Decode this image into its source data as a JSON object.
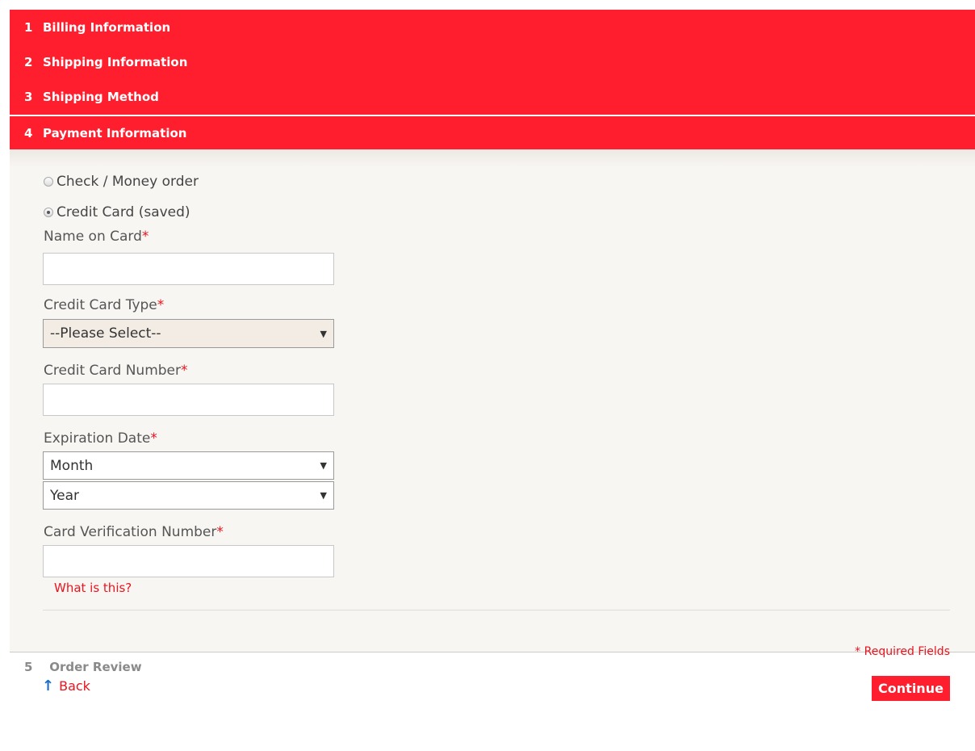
{
  "steps": [
    {
      "num": "1",
      "label": "Billing Information"
    },
    {
      "num": "2",
      "label": "Shipping Information"
    },
    {
      "num": "3",
      "label": "Shipping Method"
    },
    {
      "num": "4",
      "label": "Payment Information"
    },
    {
      "num": "5",
      "label": "Order Review"
    }
  ],
  "payment": {
    "methods": [
      {
        "label": "Check / Money order",
        "selected": false
      },
      {
        "label": "Credit Card (saved)",
        "selected": true
      }
    ],
    "name_on_card": {
      "label": "Name on Card",
      "value": ""
    },
    "card_type": {
      "label": "Credit Card Type",
      "value": "--Please Select--"
    },
    "card_number": {
      "label": "Credit Card Number",
      "value": ""
    },
    "expiration": {
      "label": "Expiration Date",
      "month": "Month",
      "year": "Year"
    },
    "cvn": {
      "label": "Card Verification Number",
      "value": "",
      "help": "What is this?"
    },
    "required_marker": "*"
  },
  "footer": {
    "required_note": "* Required Fields",
    "back": "Back",
    "continue": "Continue"
  },
  "colors": {
    "accent": "#ff1e2d",
    "link": "#e8141f",
    "panel": "#f8f6f3"
  }
}
